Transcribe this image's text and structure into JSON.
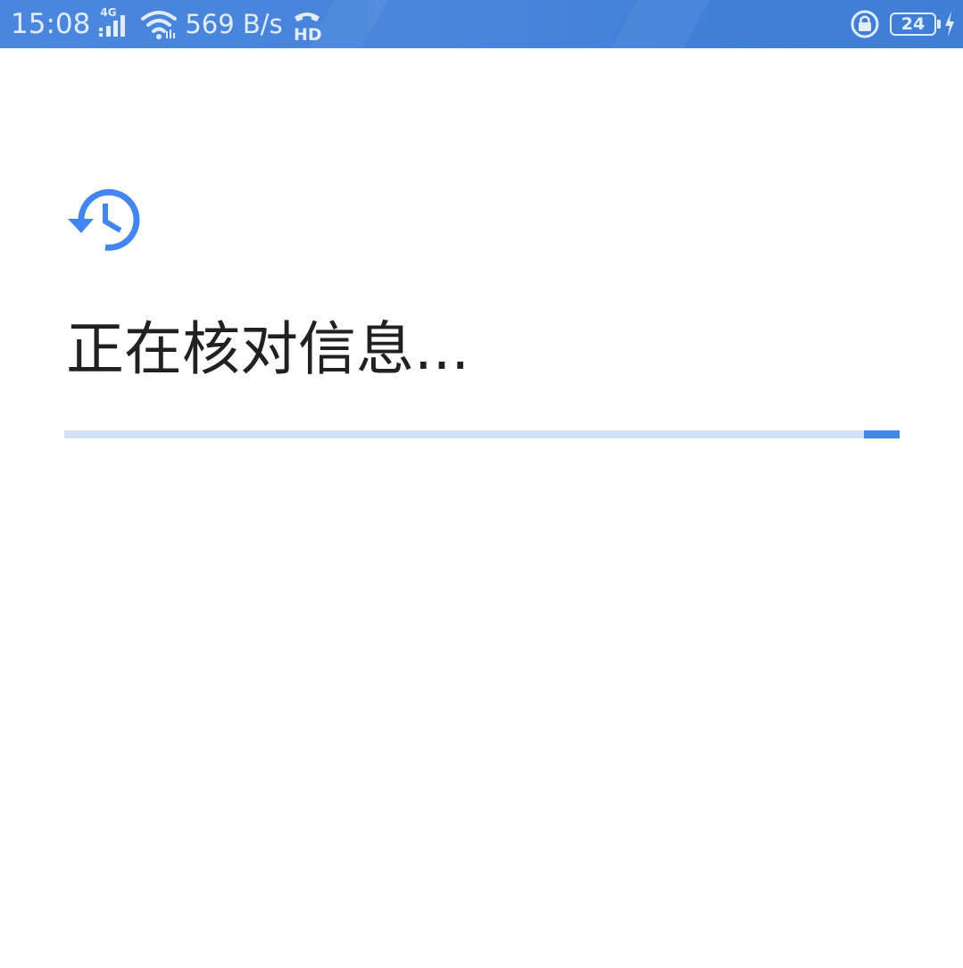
{
  "status_bar": {
    "time": "15:08",
    "network_type": "4G",
    "net_speed": "569 B/s",
    "battery_level": "24",
    "icons": [
      "signal-icon",
      "wifi-icon",
      "hd-call-icon",
      "rotation-lock-icon",
      "battery-icon",
      "charging-icon"
    ]
  },
  "main": {
    "icon": "history-icon",
    "title": "正在核对信息...",
    "progress": {
      "indeterminate": true,
      "indicator_start": 0.957,
      "indicator_end": 1.0
    }
  },
  "colors": {
    "status_bar": "#4784dc",
    "accent": "#4285f4",
    "progress_track": "#cfe0f8",
    "title_text": "#212121",
    "background": "#ffffff"
  }
}
